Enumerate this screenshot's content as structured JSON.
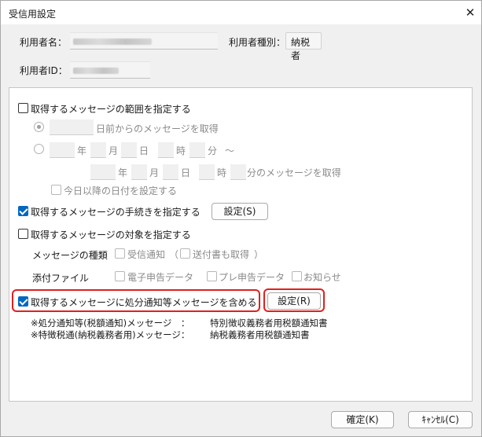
{
  "window": {
    "title": "受信用設定",
    "close_glyph": "✕"
  },
  "user": {
    "name_label": "利用者名：",
    "type_label": "利用者種別：",
    "type_value": "納税者",
    "id_label": "利用者ID："
  },
  "range": {
    "checkbox_label": "取得するメッセージの範囲を指定する",
    "option1_label": "日前からのメッセージを取得",
    "year": "年",
    "month": "月",
    "day": "日",
    "hour": "時",
    "minute": "分",
    "tilde": "～",
    "option2_suffix": "分のメッセージを取得",
    "today_label": "今日以降の日付を設定する"
  },
  "procedure": {
    "checkbox_label": "取得するメッセージの手続きを指定する",
    "button": "設定(S)"
  },
  "target": {
    "checkbox_label": "取得するメッセージの対象を指定する",
    "message_type_label": "メッセージの種類",
    "receipt_label": "受信通知",
    "paren_open": "（",
    "sent_docs_label": "送付書も取得",
    "paren_close": "）",
    "attachment_label": "添付ファイル",
    "e_filing_label": "電子申告データ",
    "pre_filing_label": "プレ申告データ",
    "notice_label": "お知らせ"
  },
  "disposal": {
    "checkbox_label": "取得するメッセージに処分通知等メッセージを含める",
    "button": "設定(R)",
    "note1_left": "※処分通知等(税額通知)メッセージ　：",
    "note1_right": "特別徴収義務者用税額通知書",
    "note2_left": "※特徴税通(納税義務者用)メッセージ：",
    "note2_right": "納税義務者用税額通知書"
  },
  "footer": {
    "ok": "確定(K)",
    "cancel": "ｷｬﾝｾﾙ(C)"
  },
  "colors": {
    "accent": "#0067c0",
    "highlight": "#e0201f"
  }
}
